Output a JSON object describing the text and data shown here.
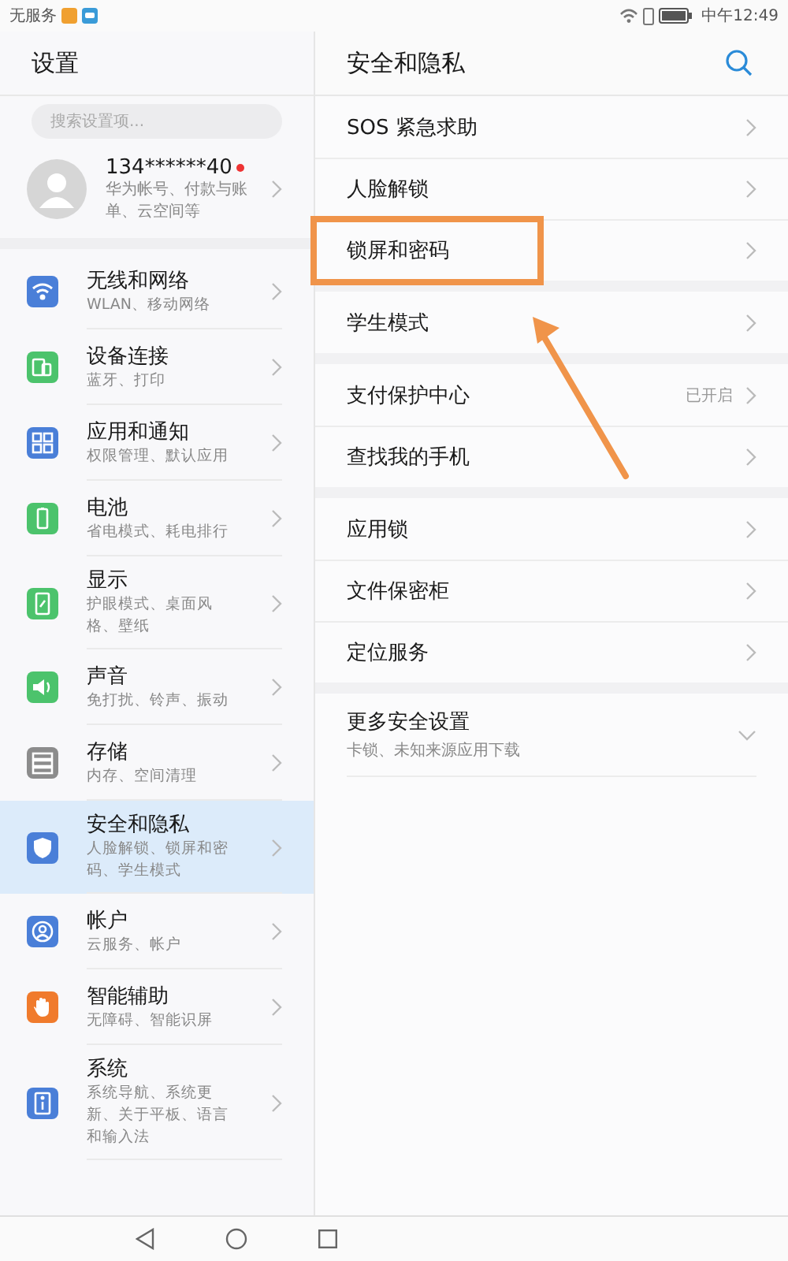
{
  "status_bar": {
    "carrier": "无服务",
    "time": "中午12:49"
  },
  "sidebar": {
    "title": "设置",
    "search": {
      "placeholder": "搜索设置项..."
    },
    "account": {
      "name": "134******40",
      "badge": true,
      "subtitle": "华为帐号、付款与账单、云空间等"
    },
    "items": [
      {
        "title": "无线和网络",
        "subtitle": "WLAN、移动网络",
        "color": "#4a7fd8",
        "selected": false
      },
      {
        "title": "设备连接",
        "subtitle": "蓝牙、打印",
        "color": "#4cc36c",
        "selected": false
      },
      {
        "title": "应用和通知",
        "subtitle": "权限管理、默认应用",
        "color": "#4a7fd8",
        "selected": false
      },
      {
        "title": "电池",
        "subtitle": "省电模式、耗电排行",
        "color": "#4cc36c",
        "selected": false
      },
      {
        "title": "显示",
        "subtitle": "护眼模式、桌面风格、壁纸",
        "color": "#4cc36c",
        "selected": false
      },
      {
        "title": "声音",
        "subtitle": "免打扰、铃声、振动",
        "color": "#4cc36c",
        "selected": false
      },
      {
        "title": "存储",
        "subtitle": "内存、空间清理",
        "color": "#8c8c8c",
        "selected": false
      },
      {
        "title": "安全和隐私",
        "subtitle": "人脸解锁、锁屏和密码、学生模式",
        "color": "#4a7fd8",
        "selected": true
      },
      {
        "title": "帐户",
        "subtitle": "云服务、帐户",
        "color": "#4a7fd8",
        "selected": false
      },
      {
        "title": "智能辅助",
        "subtitle": "无障碍、智能识屏",
        "color": "#f07b2c",
        "selected": false
      },
      {
        "title": "系统",
        "subtitle": "系统导航、系统更新、关于平板、语言和输入法",
        "color": "#4a7fd8",
        "selected": false
      }
    ]
  },
  "detail": {
    "title": "安全和隐私",
    "groups": [
      [
        {
          "kind": "link",
          "label": "SOS 紧急求助",
          "highlighted": false
        },
        {
          "kind": "link",
          "label": "人脸解锁",
          "highlighted": false
        },
        {
          "kind": "link",
          "label": "锁屏和密码",
          "highlighted": true
        }
      ],
      [
        {
          "kind": "link",
          "label": "学生模式",
          "highlighted": false
        }
      ],
      [
        {
          "kind": "link",
          "label": "支付保护中心",
          "value": "已开启",
          "highlighted": false
        },
        {
          "kind": "link",
          "label": "查找我的手机",
          "highlighted": false
        }
      ],
      [
        {
          "kind": "link",
          "label": "应用锁",
          "highlighted": false
        },
        {
          "kind": "link",
          "label": "文件保密柜",
          "highlighted": false
        },
        {
          "kind": "link",
          "label": "定位服务",
          "highlighted": false
        }
      ],
      [
        {
          "kind": "expand",
          "label": "更多安全设置",
          "subtitle": "卡锁、未知来源应用下载",
          "highlighted": false
        }
      ]
    ]
  }
}
